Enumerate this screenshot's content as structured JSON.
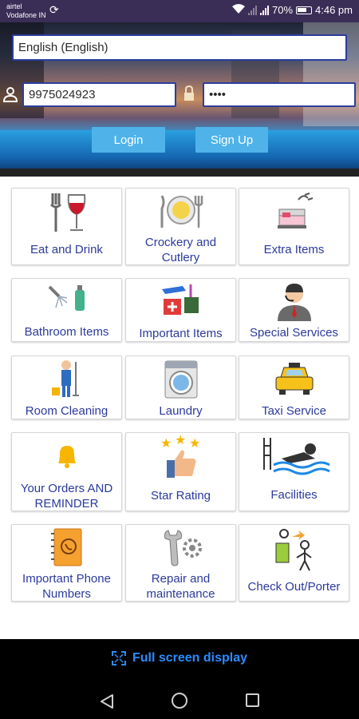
{
  "status_bar": {
    "carrier_line1": "airtel",
    "carrier_line2": "Vodafone IN",
    "battery": "70%",
    "time": "4:46 pm"
  },
  "login": {
    "language": "English (English)",
    "phone": "9975024923",
    "password_masked": "••••",
    "login_label": "Login",
    "signup_label": "Sign Up"
  },
  "tiles": [
    {
      "label": "Eat and Drink",
      "icon": "fork-wine-glass-icon"
    },
    {
      "label": "Crockery and Cutlery",
      "icon": "plate-cutlery-icon"
    },
    {
      "label": "Extra Items",
      "icon": "bed-bell-icon"
    },
    {
      "label": "Bathroom Items",
      "icon": "shower-soap-icon"
    },
    {
      "label": "Important Items",
      "icon": "first-aid-stapler-icon"
    },
    {
      "label": "Special Services",
      "icon": "receptionist-headset-icon"
    },
    {
      "label": "Room Cleaning",
      "icon": "cleaner-mop-icon"
    },
    {
      "label": "Laundry",
      "icon": "washing-machine-icon"
    },
    {
      "label": "Taxi Service",
      "icon": "taxi-icon"
    },
    {
      "label": "Your Orders AND REMINDER",
      "icon": "bell-icon"
    },
    {
      "label": "Star Rating",
      "icon": "stars-thumbs-up-icon"
    },
    {
      "label": "Facilities",
      "icon": "pool-swimmer-icon"
    },
    {
      "label": "Important Phone Numbers",
      "icon": "phone-book-icon"
    },
    {
      "label": "Repair and maintenance",
      "icon": "wrench-gear-icon"
    },
    {
      "label": "Check Out/Porter",
      "icon": "porter-luggage-icon"
    }
  ],
  "footer": {
    "fullscreen_label": "Full screen display"
  },
  "colors": {
    "tile_text": "#2b3a9c",
    "button": "#4fb3ea",
    "fullscreen_text": "#2a8cff"
  }
}
